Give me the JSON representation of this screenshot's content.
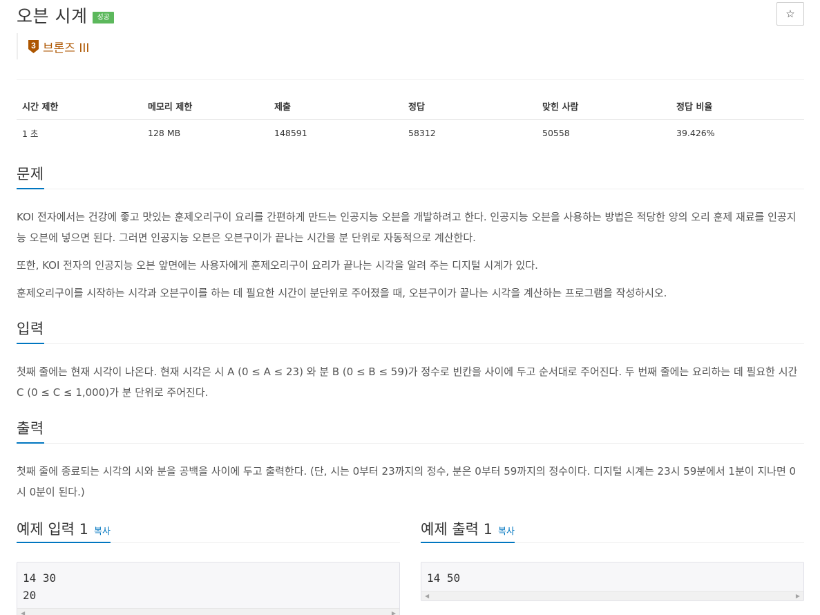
{
  "problem": {
    "title": "오븐 시계",
    "status_badge": "성공",
    "star_icon": "☆",
    "tier": {
      "label": "브론즈 III",
      "number": "3",
      "color": "#ad5600"
    }
  },
  "info_table": {
    "headers": [
      "시간 제한",
      "메모리 제한",
      "제출",
      "정답",
      "맞힌 사람",
      "정답 비율"
    ],
    "values": [
      "1 초",
      "128 MB",
      "148591",
      "58312",
      "50558",
      "39.426%"
    ]
  },
  "sections": {
    "problem": {
      "heading": "문제",
      "paragraphs": [
        "KOI 전자에서는 건강에 좋고 맛있는 훈제오리구이 요리를 간편하게 만드는 인공지능 오븐을 개발하려고 한다. 인공지능 오븐을 사용하는 방법은 적당한 양의 오리 훈제 재료를 인공지능 오븐에 넣으면 된다. 그러면 인공지능 오븐은 오븐구이가 끝나는 시간을 분 단위로 자동적으로 계산한다.",
        "또한, KOI 전자의 인공지능 오븐 앞면에는 사용자에게 훈제오리구이 요리가 끝나는 시각을 알려 주는 디지털 시계가 있다.",
        "훈제오리구이를 시작하는 시각과 오븐구이를 하는 데 필요한 시간이 분단위로 주어졌을 때, 오븐구이가 끝나는 시각을 계산하는 프로그램을 작성하시오."
      ]
    },
    "input": {
      "heading": "입력",
      "text": "첫째 줄에는 현재 시각이 나온다. 현재 시각은 시 A (0 ≤ A ≤ 23) 와 분 B (0 ≤ B ≤ 59)가 정수로 빈칸을 사이에 두고 순서대로 주어진다. 두 번째 줄에는 요리하는 데 필요한 시간 C (0 ≤ C ≤ 1,000)가 분 단위로 주어진다."
    },
    "output": {
      "heading": "출력",
      "text": "첫째 줄에 종료되는 시각의 시와 분을 공백을 사이에 두고 출력한다. (단, 시는 0부터 23까지의 정수, 분은 0부터 59까지의 정수이다. 디지털 시계는 23시 59분에서 1분이 지나면 0시 0분이 된다.)"
    }
  },
  "samples": {
    "input": {
      "heading": "예제 입력 1",
      "copy_label": "복사",
      "content": "14 30\n20"
    },
    "output": {
      "heading": "예제 출력 1",
      "copy_label": "복사",
      "content": "14 50"
    }
  },
  "colors": {
    "accent": "#0076c0",
    "success": "#5cb85c",
    "bronze": "#ad5600"
  }
}
